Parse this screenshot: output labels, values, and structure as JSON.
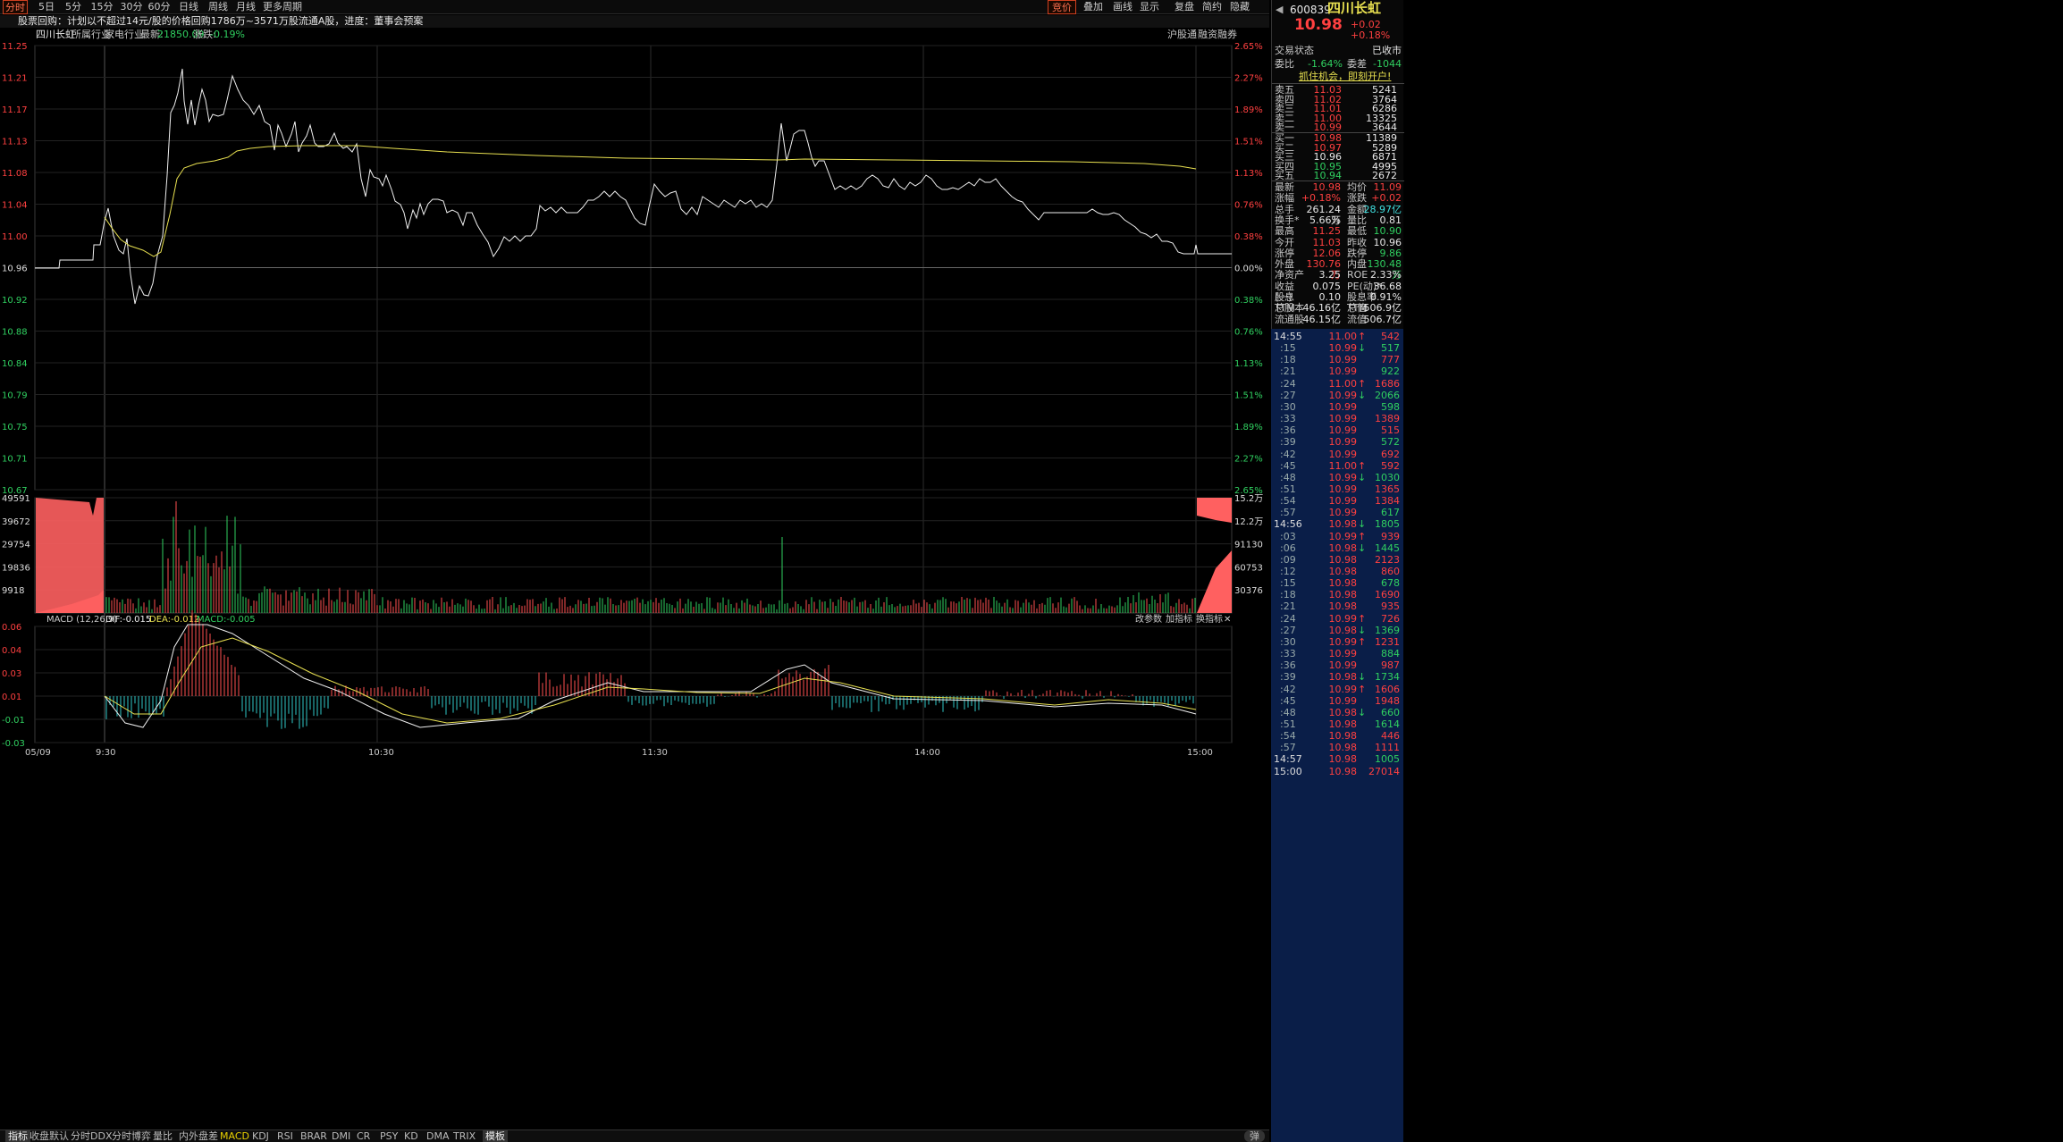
{
  "toolbar": {
    "tabs": [
      "分时",
      "5日",
      "5分钟",
      "15分钟",
      "30分钟",
      "60分钟",
      "日线",
      "周线",
      "月线",
      "更多周期"
    ],
    "right_tools": [
      "竞价",
      "叠加",
      "画线",
      "显示",
      "复盘",
      "简约",
      "隐藏"
    ]
  },
  "notice": "股票回购：计划以不超过14元/股的价格回购1786万~3571万股流通A股，进度：董事会预案",
  "info": {
    "name": "四川长虹",
    "industry_label": "所属行业:",
    "industry": "家电行业",
    "latest_label": "最新:",
    "latest": "21850.09",
    "change_label": "涨跌:",
    "change": "-0.19%",
    "hgt": "沪股通",
    "rzrq": "融资融券"
  },
  "price_axis_left": [
    "11.25",
    "11.21",
    "11.17",
    "11.13",
    "11.08",
    "11.04",
    "11.00",
    "10.96",
    "10.92",
    "10.88",
    "10.84",
    "10.79",
    "10.75",
    "10.71",
    "10.67"
  ],
  "price_axis_right": [
    "2.65%",
    "2.27%",
    "1.89%",
    "1.51%",
    "1.13%",
    "0.76%",
    "0.38%",
    "0.00%",
    "0.38%",
    "0.76%",
    "1.13%",
    "1.51%",
    "1.89%",
    "2.27%",
    "2.65%"
  ],
  "vol_axis_left": [
    "49591",
    "39672",
    "29754",
    "19836",
    "9918"
  ],
  "vol_axis_right": [
    "15.2万",
    "12.2万",
    "91130",
    "60753",
    "30376"
  ],
  "macd": {
    "title": "MACD (12,26,9)",
    "dif": "DIF:-0.015",
    "dea": "DEA:-0.012",
    "macd": "MACD:-0.005",
    "tools": [
      "改参数",
      "加指标",
      "换指标"
    ],
    "axis": [
      "0.06",
      "0.04",
      "0.03",
      "0.01",
      "-0.01",
      "-0.03"
    ]
  },
  "time_axis": [
    "05/09",
    "9:30",
    "10:30",
    "11:30",
    "14:00",
    "15:00"
  ],
  "bottom_tabs": [
    "指标",
    "收盘默认",
    "分时DDX",
    "分时博弈",
    "量比",
    "内外盘差",
    "MACD",
    "KDJ",
    "RSI",
    "BRAR",
    "DMI",
    "CR",
    "PSY",
    "KD",
    "DMA",
    "TRIX",
    "模板"
  ],
  "bottom_right": "弹",
  "quote": {
    "code": "600839",
    "name": "四川长虹",
    "price": "10.98",
    "chg": "+0.02",
    "pct": "+0.18%",
    "status_label": "交易状态",
    "status": "已收市",
    "wb_label": "委比",
    "wb": "-1.64%",
    "wc_label": "委差",
    "wc": "-1044",
    "promo": "抓住机会，即刻开户!",
    "asks": [
      [
        "卖五",
        "11.03",
        "5241"
      ],
      [
        "卖四",
        "11.02",
        "3764"
      ],
      [
        "卖三",
        "11.01",
        "6286"
      ],
      [
        "卖二",
        "11.00",
        "13325"
      ],
      [
        "卖一",
        "10.99",
        "3644"
      ]
    ],
    "bids": [
      [
        "买一",
        "10.98",
        "11389"
      ],
      [
        "买二",
        "10.97",
        "5289"
      ],
      [
        "买三",
        "10.96",
        "6871"
      ],
      [
        "买四",
        "10.95",
        "4995"
      ],
      [
        "买五",
        "10.94",
        "2672"
      ]
    ],
    "stats": [
      [
        "最新",
        "10.98",
        "均价",
        "11.09"
      ],
      [
        "涨幅",
        "+0.18%",
        "涨跌",
        "+0.02"
      ],
      [
        "总手",
        "261.24万",
        "金额",
        "28.97亿"
      ],
      [
        "换手*",
        "5.66%",
        "量比",
        "0.81"
      ],
      [
        "最高",
        "11.25",
        "最低",
        "10.90"
      ],
      [
        "今开",
        "11.03",
        "昨收",
        "10.96"
      ],
      [
        "涨停",
        "12.06",
        "跌停",
        "9.86"
      ],
      [
        "外盘",
        "130.76万",
        "内盘",
        "130.48万"
      ],
      [
        "净资产",
        "3.25",
        "ROE",
        "2.33%"
      ],
      [
        "收益(一)",
        "0.075",
        "PE(动)*",
        "36.68"
      ],
      [
        "股息TTM",
        "0.10",
        "股息率TTM",
        "0.91%"
      ],
      [
        "总股本",
        "46.16亿",
        "总值",
        "506.9亿"
      ],
      [
        "流通股",
        "46.15亿",
        "流值",
        "506.7亿"
      ]
    ]
  },
  "ticks": [
    [
      "14:55",
      "11.00",
      "↑",
      "542"
    ],
    [
      ":15",
      "10.99",
      "↓",
      "517"
    ],
    [
      ":18",
      "10.99",
      "",
      "777"
    ],
    [
      ":21",
      "10.99",
      "",
      "922"
    ],
    [
      ":24",
      "11.00",
      "↑",
      "1686"
    ],
    [
      ":27",
      "10.99",
      "↓",
      "2066"
    ],
    [
      ":30",
      "10.99",
      "",
      "598"
    ],
    [
      ":33",
      "10.99",
      "",
      "1389"
    ],
    [
      ":36",
      "10.99",
      "",
      "515"
    ],
    [
      ":39",
      "10.99",
      "",
      "572"
    ],
    [
      ":42",
      "10.99",
      "",
      "692"
    ],
    [
      ":45",
      "11.00",
      "↑",
      "592"
    ],
    [
      ":48",
      "10.99",
      "↓",
      "1030"
    ],
    [
      ":51",
      "10.99",
      "",
      "1365"
    ],
    [
      ":54",
      "10.99",
      "",
      "1384"
    ],
    [
      ":57",
      "10.99",
      "",
      "617"
    ],
    [
      "14:56",
      "10.98",
      "↓",
      "1805"
    ],
    [
      ":03",
      "10.99",
      "↑",
      "939"
    ],
    [
      ":06",
      "10.98",
      "↓",
      "1445"
    ],
    [
      ":09",
      "10.98",
      "",
      "2123"
    ],
    [
      ":12",
      "10.98",
      "",
      "860"
    ],
    [
      ":15",
      "10.98",
      "",
      "678"
    ],
    [
      ":18",
      "10.98",
      "",
      "1690"
    ],
    [
      ":21",
      "10.98",
      "",
      "935"
    ],
    [
      ":24",
      "10.99",
      "↑",
      "726"
    ],
    [
      ":27",
      "10.98",
      "↓",
      "1369"
    ],
    [
      ":30",
      "10.99",
      "↑",
      "1231"
    ],
    [
      ":33",
      "10.99",
      "",
      "884"
    ],
    [
      ":36",
      "10.99",
      "",
      "987"
    ],
    [
      ":39",
      "10.98",
      "↓",
      "1734"
    ],
    [
      ":42",
      "10.99",
      "↑",
      "1606"
    ],
    [
      ":45",
      "10.99",
      "",
      "1948"
    ],
    [
      ":48",
      "10.98",
      "↓",
      "660"
    ],
    [
      ":51",
      "10.98",
      "",
      "1614"
    ],
    [
      ":54",
      "10.98",
      "",
      "446"
    ],
    [
      ":57",
      "10.98",
      "",
      "1111"
    ],
    [
      "14:57",
      "10.98",
      "",
      "1005"
    ],
    [
      "15:00",
      "10.98",
      "",
      "27014"
    ]
  ]
}
